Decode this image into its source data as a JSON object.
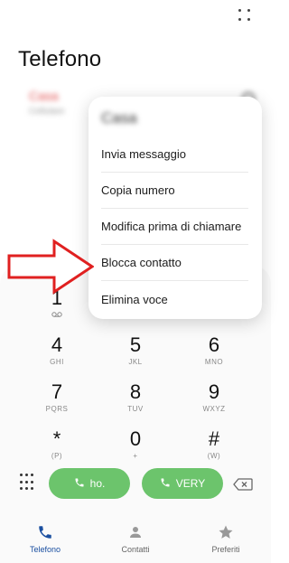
{
  "header": {
    "title": "Telefono",
    "more_icon": "more-options-icon"
  },
  "call_log": {
    "name": "Casa",
    "subtitle": "Cellulare"
  },
  "menu": {
    "header": "Casa",
    "items": [
      {
        "label": "Invia messaggio"
      },
      {
        "label": "Copia numero"
      },
      {
        "label": "Modifica prima di chiamare"
      },
      {
        "label": "Blocca contatto"
      },
      {
        "label": "Elimina voce"
      }
    ]
  },
  "keypad": {
    "keys": [
      {
        "digit": "1",
        "letters": ""
      },
      {
        "digit": "",
        "letters": ""
      },
      {
        "digit": "",
        "letters": ""
      },
      {
        "digit": "4",
        "letters": "GHI"
      },
      {
        "digit": "5",
        "letters": "JKL"
      },
      {
        "digit": "6",
        "letters": "MNO"
      },
      {
        "digit": "7",
        "letters": "PQRS"
      },
      {
        "digit": "8",
        "letters": "TUV"
      },
      {
        "digit": "9",
        "letters": "WXYZ"
      },
      {
        "digit": "*",
        "letters": "(P)"
      },
      {
        "digit": "0",
        "letters": "+"
      },
      {
        "digit": "#",
        "letters": "(W)"
      }
    ]
  },
  "actions": {
    "call1_label": "ho.",
    "call2_label": "VERY",
    "call_color": "#6cc46c"
  },
  "nav": {
    "items": [
      {
        "label": "Telefono",
        "active": true
      },
      {
        "label": "Contatti",
        "active": false
      },
      {
        "label": "Preferiti",
        "active": false
      }
    ],
    "active_color": "#1a4fa0"
  },
  "annotation": {
    "arrow_color": "#e02020"
  }
}
